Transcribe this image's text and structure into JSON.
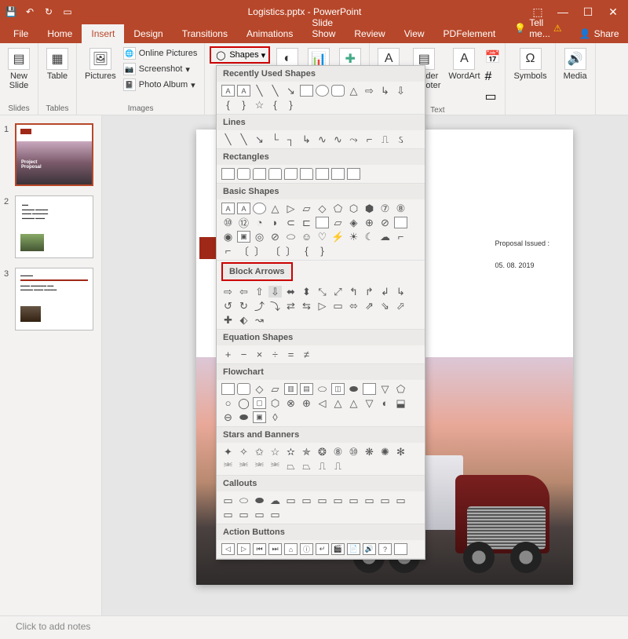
{
  "title": "Logistics.pptx - PowerPoint",
  "tabs": {
    "file": "File",
    "home": "Home",
    "insert": "Insert",
    "design": "Design",
    "transitions": "Transitions",
    "animations": "Animations",
    "slideshow": "Slide Show",
    "review": "Review",
    "view": "View",
    "pdfelement": "PDFelement",
    "tellme": "Tell me...",
    "share": "Share"
  },
  "ribbon": {
    "newslide": "New\nSlide",
    "slides": "Slides",
    "table": "Table",
    "tables": "Tables",
    "pictures": "Pictures",
    "onlinepics": "Online Pictures",
    "screenshot": "Screenshot",
    "photoalbum": "Photo Album",
    "images": "Images",
    "shapes": "Shapes",
    "textbox_partial": "x",
    "header": "Header\n& Footer",
    "wordart": "WordArt",
    "text": "Text",
    "symbols": "Symbols",
    "media": "Media"
  },
  "shapes_panel": {
    "recent": "Recently Used Shapes",
    "lines": "Lines",
    "rectangles": "Rectangles",
    "basic": "Basic Shapes",
    "blockarrows": "Block Arrows",
    "equation": "Equation Shapes",
    "flowchart": "Flowchart",
    "stars": "Stars and Banners",
    "callouts": "Callouts",
    "action": "Action Buttons"
  },
  "slide_content": {
    "proposal_issued": "Proposal Issued :",
    "date": "05. 08. 2019",
    "th1_title": "Project\nProposal"
  },
  "notes": "Click to add notes",
  "thumbs": {
    "n1": "1",
    "n2": "2",
    "n3": "3"
  }
}
